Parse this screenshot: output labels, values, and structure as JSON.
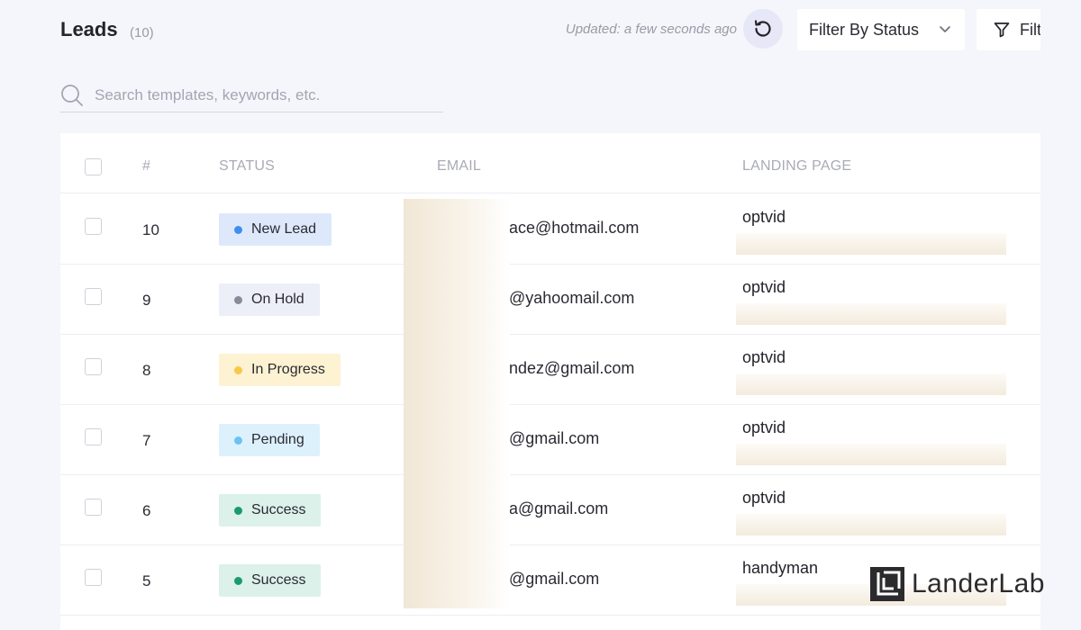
{
  "header": {
    "title": "Leads",
    "count": "(10)",
    "updated": "Updated: a few seconds ago",
    "status_filter": "Filter By Status",
    "filter_button": "Filt"
  },
  "search": {
    "placeholder": "Search templates, keywords, etc."
  },
  "table": {
    "columns": {
      "num": "#",
      "status": "STATUS",
      "email": "EMAIL",
      "landing": "LANDING PAGE"
    },
    "rows": [
      {
        "num": "10",
        "status": "New Lead",
        "email": "ace@hotmail.com",
        "landing": "optvid"
      },
      {
        "num": "9",
        "status": "On Hold",
        "email": "@yahoomail.com",
        "landing": "optvid"
      },
      {
        "num": "8",
        "status": "In Progress",
        "email": "ndez@gmail.com",
        "landing": "optvid"
      },
      {
        "num": "7",
        "status": "Pending",
        "email": "@gmail.com",
        "landing": "optvid"
      },
      {
        "num": "6",
        "status": "Success",
        "email": "a@gmail.com",
        "landing": "optvid"
      },
      {
        "num": "5",
        "status": "Success",
        "email": "@gmail.com",
        "landing": "handyman"
      }
    ]
  },
  "status_colors": {
    "New Lead": {
      "bg": "#dde9fb",
      "dot": "#3f8ef0"
    },
    "On Hold": {
      "bg": "#eceef8",
      "dot": "#8a8b99"
    },
    "In Progress": {
      "bg": "#fdf2d2",
      "dot": "#f7c948"
    },
    "Pending": {
      "bg": "#ddf1fc",
      "dot": "#6cc3f2"
    },
    "Success": {
      "bg": "#dcf1ea",
      "dot": "#1b9a6e"
    }
  },
  "icons": {
    "refresh": "refresh-icon",
    "chevron": "chevron-down-icon",
    "filter": "filter-icon",
    "search": "search-icon"
  },
  "logo": {
    "text": "LanderLab"
  }
}
